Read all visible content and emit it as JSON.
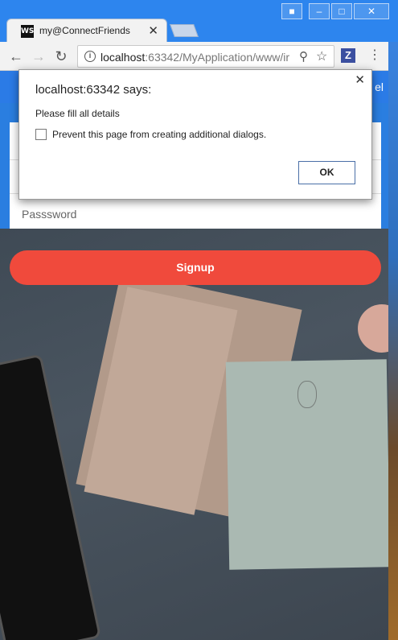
{
  "window": {
    "min_icon": "minimize-icon",
    "max_icon": "maximize-icon",
    "close_icon": "close-icon",
    "user_icon": "user-icon"
  },
  "tab": {
    "favicon_text": "WS",
    "title": "my@ConnectFriends"
  },
  "toolbar": {
    "url_host": "localhost",
    "url_path": ":63342/MyApplication/www/ir",
    "ext_label": "Z"
  },
  "page": {
    "header_right": "el",
    "password_placeholder": "Passsword",
    "signup_label": "Signup"
  },
  "dialog": {
    "title": "localhost:63342 says:",
    "message": "Please fill all details",
    "checkbox_label": "Prevent this page from creating additional dialogs.",
    "ok_label": "OK"
  },
  "colors": {
    "frame": "#2d85ee",
    "signup": "#f04a3c",
    "header": "#2b7be6"
  }
}
